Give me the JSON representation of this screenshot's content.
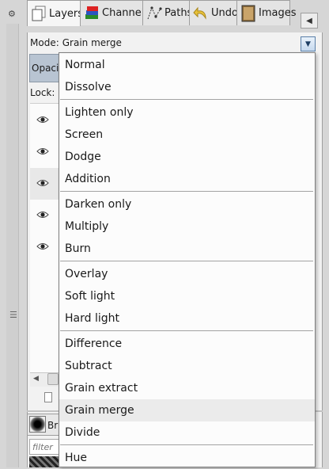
{
  "tabs": [
    {
      "label": "Layers",
      "icon": "layers-icon",
      "active": true
    },
    {
      "label": "Channels",
      "icon": "channels-icon",
      "active": false
    },
    {
      "label": "Paths",
      "icon": "paths-icon",
      "active": false
    },
    {
      "label": "Undo",
      "icon": "undo-icon",
      "active": false
    },
    {
      "label": "Images",
      "icon": "images-icon",
      "active": false
    }
  ],
  "mode": {
    "label": "Mode:",
    "value": "Grain merge"
  },
  "opacity_label": "Opaci",
  "lock_label": "Lock:",
  "brushes": {
    "label": "Br",
    "filter_placeholder": "filter"
  },
  "menu": {
    "groups": [
      [
        "Normal",
        "Dissolve"
      ],
      [
        "Lighten only",
        "Screen",
        "Dodge",
        "Addition"
      ],
      [
        "Darken only",
        "Multiply",
        "Burn"
      ],
      [
        "Overlay",
        "Soft light",
        "Hard light"
      ],
      [
        "Difference",
        "Subtract",
        "Grain extract",
        "Grain merge",
        "Divide"
      ],
      [
        "Hue"
      ]
    ],
    "highlighted": "Grain merge"
  },
  "colors": {
    "selection_blue": "#b8c4d2",
    "highlight_gray": "#ebebeb",
    "accent_blue": "#5a7fa8"
  }
}
